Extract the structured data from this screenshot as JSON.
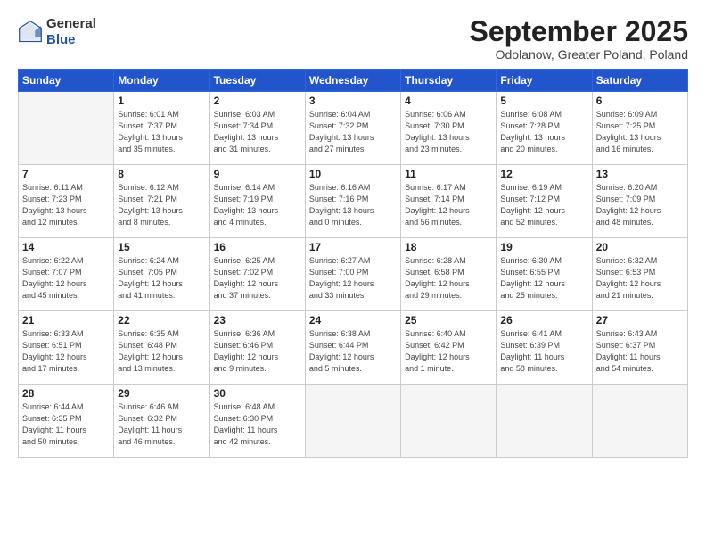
{
  "logo": {
    "general": "General",
    "blue": "Blue"
  },
  "title": "September 2025",
  "subtitle": "Odolanow, Greater Poland, Poland",
  "headers": [
    "Sunday",
    "Monday",
    "Tuesday",
    "Wednesday",
    "Thursday",
    "Friday",
    "Saturday"
  ],
  "weeks": [
    [
      {
        "day": "",
        "detail": "",
        "empty": true
      },
      {
        "day": "1",
        "detail": "Sunrise: 6:01 AM\nSunset: 7:37 PM\nDaylight: 13 hours\nand 35 minutes."
      },
      {
        "day": "2",
        "detail": "Sunrise: 6:03 AM\nSunset: 7:34 PM\nDaylight: 13 hours\nand 31 minutes."
      },
      {
        "day": "3",
        "detail": "Sunrise: 6:04 AM\nSunset: 7:32 PM\nDaylight: 13 hours\nand 27 minutes."
      },
      {
        "day": "4",
        "detail": "Sunrise: 6:06 AM\nSunset: 7:30 PM\nDaylight: 13 hours\nand 23 minutes."
      },
      {
        "day": "5",
        "detail": "Sunrise: 6:08 AM\nSunset: 7:28 PM\nDaylight: 13 hours\nand 20 minutes."
      },
      {
        "day": "6",
        "detail": "Sunrise: 6:09 AM\nSunset: 7:25 PM\nDaylight: 13 hours\nand 16 minutes."
      }
    ],
    [
      {
        "day": "7",
        "detail": "Sunrise: 6:11 AM\nSunset: 7:23 PM\nDaylight: 13 hours\nand 12 minutes."
      },
      {
        "day": "8",
        "detail": "Sunrise: 6:12 AM\nSunset: 7:21 PM\nDaylight: 13 hours\nand 8 minutes."
      },
      {
        "day": "9",
        "detail": "Sunrise: 6:14 AM\nSunset: 7:19 PM\nDaylight: 13 hours\nand 4 minutes."
      },
      {
        "day": "10",
        "detail": "Sunrise: 6:16 AM\nSunset: 7:16 PM\nDaylight: 13 hours\nand 0 minutes."
      },
      {
        "day": "11",
        "detail": "Sunrise: 6:17 AM\nSunset: 7:14 PM\nDaylight: 12 hours\nand 56 minutes."
      },
      {
        "day": "12",
        "detail": "Sunrise: 6:19 AM\nSunset: 7:12 PM\nDaylight: 12 hours\nand 52 minutes."
      },
      {
        "day": "13",
        "detail": "Sunrise: 6:20 AM\nSunset: 7:09 PM\nDaylight: 12 hours\nand 48 minutes."
      }
    ],
    [
      {
        "day": "14",
        "detail": "Sunrise: 6:22 AM\nSunset: 7:07 PM\nDaylight: 12 hours\nand 45 minutes."
      },
      {
        "day": "15",
        "detail": "Sunrise: 6:24 AM\nSunset: 7:05 PM\nDaylight: 12 hours\nand 41 minutes."
      },
      {
        "day": "16",
        "detail": "Sunrise: 6:25 AM\nSunset: 7:02 PM\nDaylight: 12 hours\nand 37 minutes."
      },
      {
        "day": "17",
        "detail": "Sunrise: 6:27 AM\nSunset: 7:00 PM\nDaylight: 12 hours\nand 33 minutes."
      },
      {
        "day": "18",
        "detail": "Sunrise: 6:28 AM\nSunset: 6:58 PM\nDaylight: 12 hours\nand 29 minutes."
      },
      {
        "day": "19",
        "detail": "Sunrise: 6:30 AM\nSunset: 6:55 PM\nDaylight: 12 hours\nand 25 minutes."
      },
      {
        "day": "20",
        "detail": "Sunrise: 6:32 AM\nSunset: 6:53 PM\nDaylight: 12 hours\nand 21 minutes."
      }
    ],
    [
      {
        "day": "21",
        "detail": "Sunrise: 6:33 AM\nSunset: 6:51 PM\nDaylight: 12 hours\nand 17 minutes."
      },
      {
        "day": "22",
        "detail": "Sunrise: 6:35 AM\nSunset: 6:48 PM\nDaylight: 12 hours\nand 13 minutes."
      },
      {
        "day": "23",
        "detail": "Sunrise: 6:36 AM\nSunset: 6:46 PM\nDaylight: 12 hours\nand 9 minutes."
      },
      {
        "day": "24",
        "detail": "Sunrise: 6:38 AM\nSunset: 6:44 PM\nDaylight: 12 hours\nand 5 minutes."
      },
      {
        "day": "25",
        "detail": "Sunrise: 6:40 AM\nSunset: 6:42 PM\nDaylight: 12 hours\nand 1 minute."
      },
      {
        "day": "26",
        "detail": "Sunrise: 6:41 AM\nSunset: 6:39 PM\nDaylight: 11 hours\nand 58 minutes."
      },
      {
        "day": "27",
        "detail": "Sunrise: 6:43 AM\nSunset: 6:37 PM\nDaylight: 11 hours\nand 54 minutes."
      }
    ],
    [
      {
        "day": "28",
        "detail": "Sunrise: 6:44 AM\nSunset: 6:35 PM\nDaylight: 11 hours\nand 50 minutes."
      },
      {
        "day": "29",
        "detail": "Sunrise: 6:46 AM\nSunset: 6:32 PM\nDaylight: 11 hours\nand 46 minutes."
      },
      {
        "day": "30",
        "detail": "Sunrise: 6:48 AM\nSunset: 6:30 PM\nDaylight: 11 hours\nand 42 minutes."
      },
      {
        "day": "",
        "detail": "",
        "empty": true
      },
      {
        "day": "",
        "detail": "",
        "empty": true
      },
      {
        "day": "",
        "detail": "",
        "empty": true
      },
      {
        "day": "",
        "detail": "",
        "empty": true
      }
    ]
  ]
}
